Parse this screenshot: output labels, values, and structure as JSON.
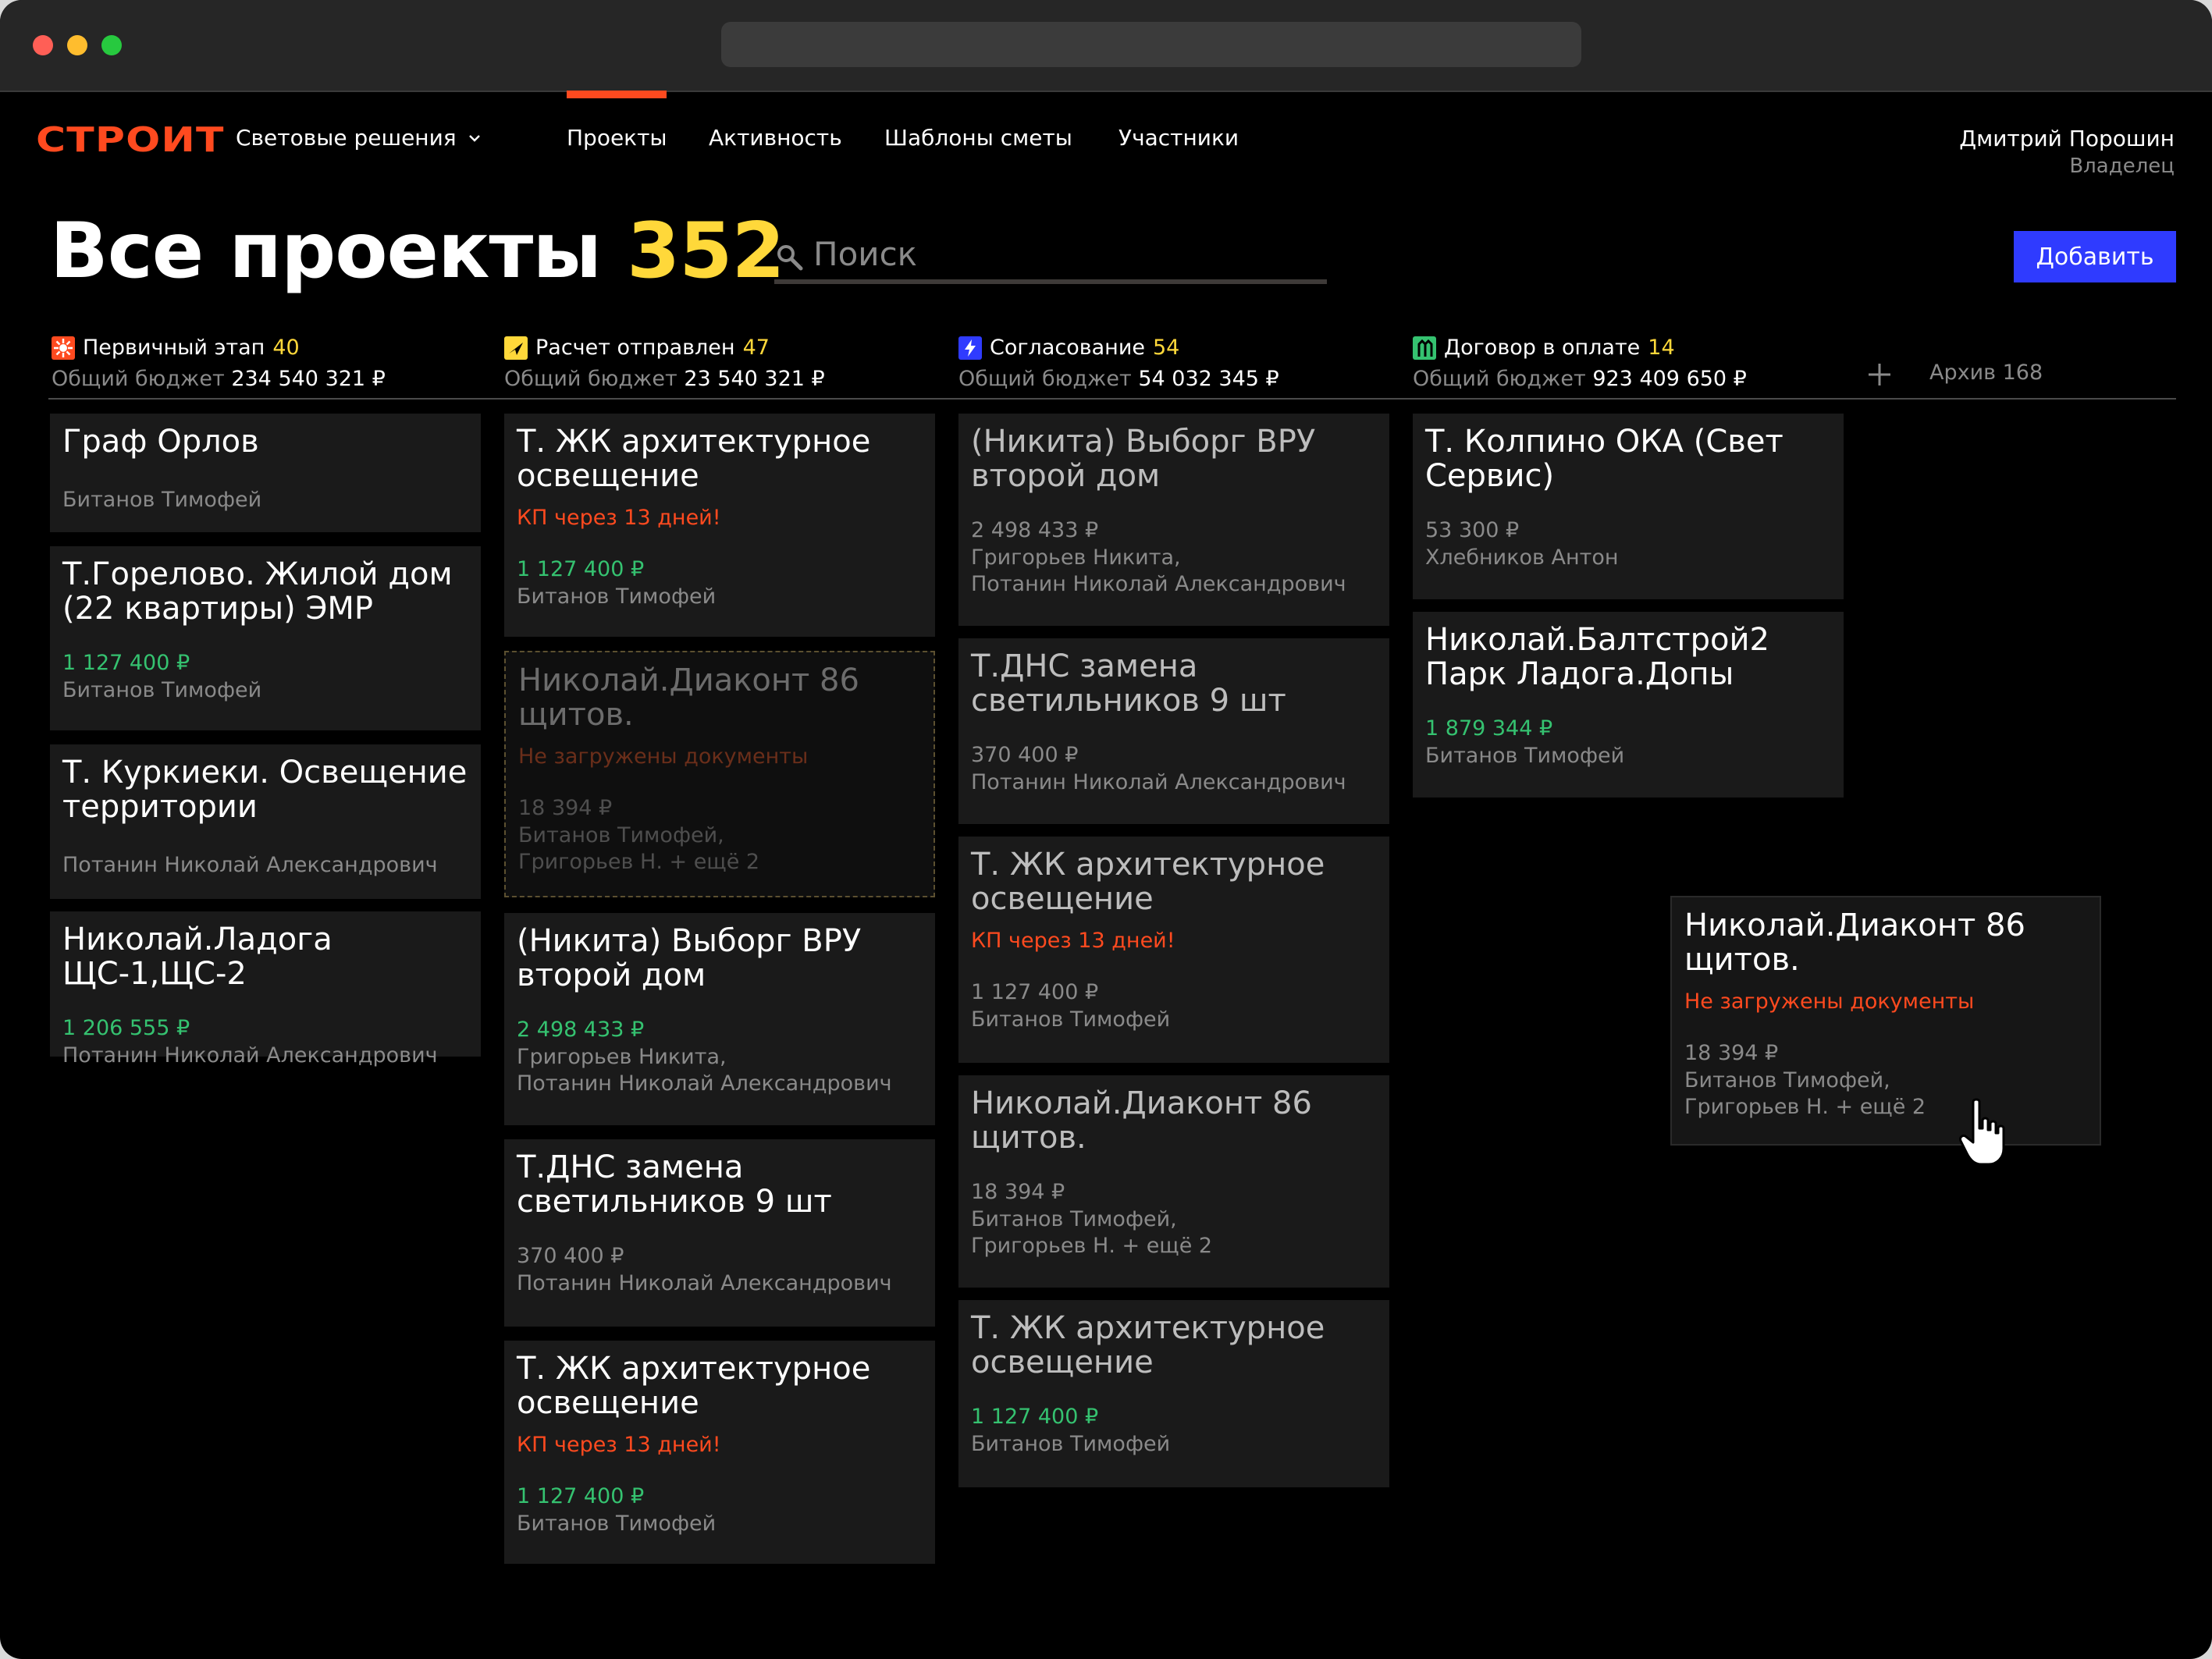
{
  "app": {
    "logo": "СТРОИТ",
    "org": "Световые решения",
    "nav": [
      {
        "label": "Проекты",
        "active": true
      },
      {
        "label": "Активность",
        "active": false
      },
      {
        "label": "Шаблоны сметы",
        "active": false
      },
      {
        "label": "Участники",
        "active": false
      }
    ],
    "user": {
      "name": "Дмитрий Порошин",
      "role": "Владелец"
    },
    "accent": "#ff4a1f"
  },
  "page": {
    "title": "Все проекты",
    "count": "352",
    "search_placeholder": "Поиск",
    "add_label": "Добавить",
    "archive_label": "Архив 168",
    "budget_label": "Общий бюджет"
  },
  "columns": [
    {
      "title": "Первичный этап",
      "count": "40",
      "budget": "234 540 321 ₽",
      "icon": "sun-icon",
      "icon_color": "#ff4a1f",
      "cards": [
        {
          "title": "Граф Орлов",
          "warn": "",
          "amount": "",
          "people": [
            "Битанов Тимофей"
          ]
        },
        {
          "title": "Т.Горелово. Жилой дом (22 квартиры) ЭМР",
          "warn": "",
          "amount": "1 127 400 ₽",
          "people": [
            "Битанов Тимофей"
          ]
        },
        {
          "title": "Т. Куркиеки. Освещение территории",
          "warn": "",
          "amount": "",
          "people": [
            "Потанин Николай Александрович"
          ]
        },
        {
          "title": "Николай.Ладога ЩС-1,ЩС-2",
          "warn": "",
          "amount": "1 206 555 ₽",
          "people": [
            "Потанин Николай Александрович"
          ]
        }
      ]
    },
    {
      "title": "Расчет отправлен",
      "count": "47",
      "budget": "23 540 321 ₽",
      "icon": "send-icon",
      "icon_color": "#ffd83a",
      "cards": [
        {
          "title": "Т. ЖК архитектурное освещение",
          "warn": "КП через 13 дней!",
          "amount": "1 127 400 ₽",
          "people": [
            "Битанов Тимофей"
          ]
        },
        {
          "title": "Николай.Диаконт 86 щитов.",
          "warn": "Не загружены документы",
          "amount": "18 394 ₽",
          "people": [
            "Битанов Тимофей,",
            "Григорьев Н. + ещё 2"
          ]
        },
        {
          "title": "(Никита) Выборг ВРУ второй дом",
          "warn": "",
          "amount": "2 498 433 ₽",
          "people": [
            "Григорьев Никита,",
            "Потанин Николай Александрович"
          ]
        },
        {
          "title": "Т.ДНС замена светильников 9 шт",
          "warn": "",
          "amount": "370 400 ₽",
          "people": [
            "Потанин Николай Александрович"
          ]
        },
        {
          "title": "Т. ЖК архитектурное освещение",
          "warn": "КП через 13 дней!",
          "amount": "1 127 400 ₽",
          "people": [
            "Битанов Тимофей"
          ]
        }
      ]
    },
    {
      "title": "Согласование",
      "count": "54",
      "budget": "54 032 345 ₽",
      "icon": "bolt-icon",
      "icon_color": "#2f3bff",
      "cards": [
        {
          "title": "(Никита) Выборг ВРУ второй дом",
          "warn": "",
          "amount": "2 498 433 ₽",
          "people": [
            "Григорьев Никита,",
            "Потанин Николай Александрович"
          ]
        },
        {
          "title": "Т.ДНС замена светильников 9 шт",
          "warn": "",
          "amount": "370 400 ₽",
          "people": [
            "Потанин Николай Александрович"
          ]
        },
        {
          "title": "Т. ЖК архитектурное освещение",
          "warn": "КП через 13 дней!",
          "amount": "1 127 400 ₽",
          "people": [
            "Битанов Тимофей"
          ]
        },
        {
          "title": "Николай.Диаконт 86 щитов.",
          "warn": "",
          "amount": "18 394 ₽",
          "people": [
            "Битанов Тимофей,",
            "Григорьев Н. + ещё 2"
          ]
        },
        {
          "title": "Т. ЖК архитектурное освещение",
          "warn": "",
          "amount": "1 127 400 ₽",
          "people": [
            "Битанов Тимофей"
          ]
        }
      ]
    },
    {
      "title": "Договор в оплате",
      "count": "14",
      "budget": "923 409 650 ₽",
      "icon": "contract-icon",
      "icon_color": "#35c270",
      "cards": [
        {
          "title": "Т. Колпино ОКА (Свет Сервис)",
          "warn": "",
          "amount": "53 300 ₽",
          "people": [
            "Хлебников Антон"
          ]
        },
        {
          "title": "Николай.Балтстрой2 Парк Ладога.Допы",
          "warn": "",
          "amount": "1 879 344 ₽",
          "people": [
            "Битанов Тимофей"
          ]
        }
      ]
    }
  ],
  "dragging_card": {
    "title": "Николай.Диаконт 86 щитов.",
    "warn": "Не загружены документы",
    "amount": "18 394 ₽",
    "people": [
      "Битанов Тимофей,",
      "Григорьев Н. + ещё 2"
    ]
  }
}
